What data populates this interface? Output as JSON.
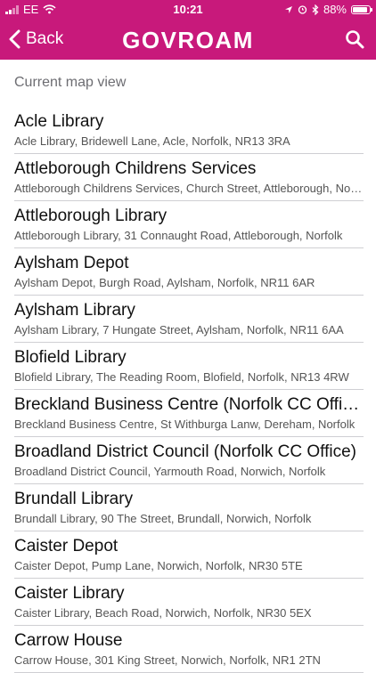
{
  "status_bar": {
    "carrier": "EE",
    "time": "10:21",
    "battery": "88%",
    "battery_level": 0.88
  },
  "nav": {
    "back_label": "Back",
    "brand": "GOVROAM"
  },
  "section_header": "Current map view",
  "items": [
    {
      "title": "Acle Library",
      "subtitle": "Acle Library, Bridewell Lane, Acle, Norfolk, NR13 3RA"
    },
    {
      "title": "Attleborough Childrens Services",
      "subtitle": "Attleborough Childrens Services, Church Street, Attleborough, Norfolk"
    },
    {
      "title": "Attleborough Library",
      "subtitle": "Attleborough Library, 31 Connaught Road, Attleborough, Norfolk"
    },
    {
      "title": "Aylsham Depot",
      "subtitle": "Aylsham Depot, Burgh Road, Aylsham, Norfolk, NR11 6AR"
    },
    {
      "title": "Aylsham Library",
      "subtitle": "Aylsham Library, 7 Hungate Street, Aylsham, Norfolk, NR11 6AA"
    },
    {
      "title": "Blofield Library",
      "subtitle": "Blofield Library, The Reading Room, Blofield, Norfolk, NR13 4RW"
    },
    {
      "title": "Breckland Business Centre (Norfolk CC Office)",
      "subtitle": "Breckland Business Centre, St Withburga Lanw, Dereham, Norfolk"
    },
    {
      "title": "Broadland District Council (Norfolk CC Office)",
      "subtitle": "Broadland District Council, Yarmouth Road, Norwich, Norfolk"
    },
    {
      "title": "Brundall Library",
      "subtitle": "Brundall Library, 90 The Street, Brundall, Norwich, Norfolk"
    },
    {
      "title": "Caister Depot",
      "subtitle": "Caister Depot, Pump Lane, Norwich, Norfolk, NR30 5TE"
    },
    {
      "title": "Caister Library",
      "subtitle": "Caister Library, Beach Road, Norwich, Norfolk, NR30 5EX"
    },
    {
      "title": "Carrow House",
      "subtitle": "Carrow House, 301 King Street, Norwich, Norfolk, NR1 2TN"
    }
  ]
}
